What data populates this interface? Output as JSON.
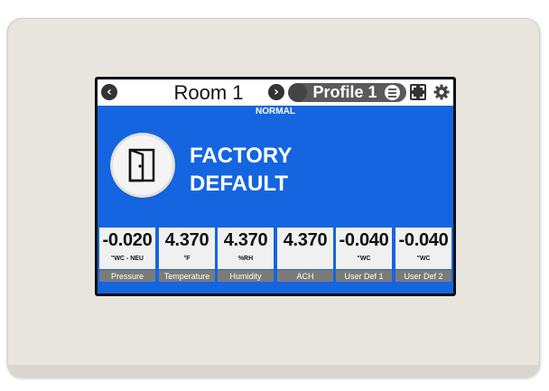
{
  "header": {
    "room_title": "Room 1",
    "profile_title": "Profile 1",
    "prev_icon": "chevron-left-icon",
    "next_icon": "chevron-right-icon",
    "menu_icon": "menu-icon",
    "fullscreen_icon": "fullscreen-icon",
    "settings_icon": "gear-icon"
  },
  "status": {
    "text": "NORMAL"
  },
  "mode": {
    "line1": "FACTORY",
    "line2": "DEFAULT",
    "icon": "door-icon"
  },
  "tiles": [
    {
      "value": "-0.020",
      "unit": "\"WC - NEU",
      "label": "Pressure"
    },
    {
      "value": "4.370",
      "unit": "°F",
      "label": "Temperature"
    },
    {
      "value": "4.370",
      "unit": "%RH",
      "label": "Humidity"
    },
    {
      "value": "4.370",
      "unit": "",
      "label": "ACH"
    },
    {
      "value": "-0.040",
      "unit": "\"WC",
      "label": "User Def 1"
    },
    {
      "value": "-0.040",
      "unit": "\"WC",
      "label": "User Def 2"
    }
  ],
  "colors": {
    "screen_blue": "#1565e0",
    "bezel": "#e7e5dd",
    "tile_label_bg": "#7b7b7b"
  }
}
